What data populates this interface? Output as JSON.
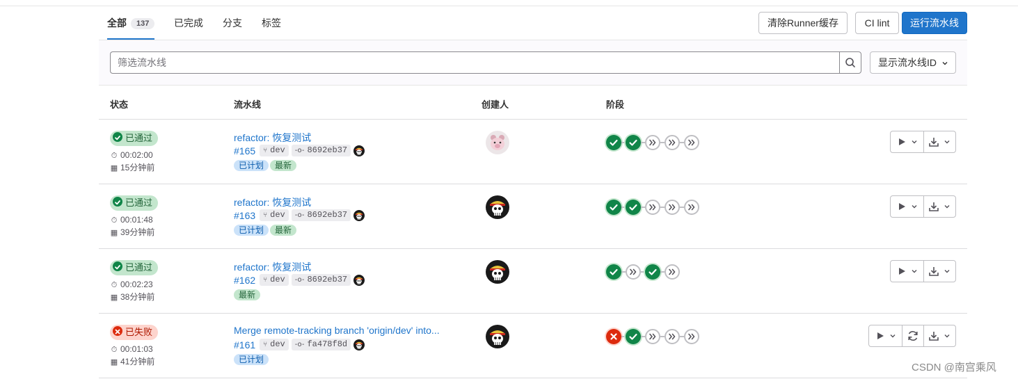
{
  "tabs": [
    {
      "label": "全部",
      "count": "137"
    },
    {
      "label": "已完成"
    },
    {
      "label": "分支"
    },
    {
      "label": "标签"
    }
  ],
  "actions": {
    "clear_cache": "清除Runner缓存",
    "ci_lint": "CI lint",
    "run_pipeline": "运行流水线"
  },
  "filter": {
    "placeholder": "筛选流水线",
    "id_select": "显示流水线ID"
  },
  "columns": {
    "status": "状态",
    "pipeline": "流水线",
    "creator": "创建人",
    "stages": "阶段"
  },
  "rows": [
    {
      "status": "已通过",
      "status_kind": "passed",
      "duration": "00:02:00",
      "finished": "15分钟前",
      "title": "refactor: 恢复测试",
      "id": "#165",
      "branch": "dev",
      "commit": "8692eb37",
      "badges": [
        {
          "label": "已计划",
          "kind": "blue"
        },
        {
          "label": "最新",
          "kind": "green"
        }
      ],
      "avatar": "pig",
      "stages": [
        "passed",
        "passed",
        "skipped",
        "skipped",
        "skipped"
      ],
      "has_retry": false
    },
    {
      "status": "已通过",
      "status_kind": "passed",
      "duration": "00:01:48",
      "finished": "39分钟前",
      "title": "refactor: 恢复测试",
      "id": "#163",
      "branch": "dev",
      "commit": "8692eb37",
      "badges": [
        {
          "label": "已计划",
          "kind": "blue"
        },
        {
          "label": "最新",
          "kind": "green"
        }
      ],
      "avatar": "skull",
      "stages": [
        "passed",
        "passed",
        "skipped",
        "skipped",
        "skipped"
      ],
      "has_retry": false
    },
    {
      "status": "已通过",
      "status_kind": "passed",
      "duration": "00:02:23",
      "finished": "38分钟前",
      "title": "refactor: 恢复测试",
      "id": "#162",
      "branch": "dev",
      "commit": "8692eb37",
      "badges": [
        {
          "label": "最新",
          "kind": "green"
        }
      ],
      "avatar": "skull",
      "stages": [
        "passed",
        "skipped",
        "passed",
        "skipped"
      ],
      "has_retry": false
    },
    {
      "status": "已失败",
      "status_kind": "failed",
      "duration": "00:01:03",
      "finished": "41分钟前",
      "title": "Merge remote-tracking branch 'origin/dev' into...",
      "id": "#161",
      "branch": "dev",
      "commit": "fa478f8d",
      "badges": [
        {
          "label": "已计划",
          "kind": "blue"
        }
      ],
      "avatar": "skull",
      "stages": [
        "failed",
        "passed",
        "skipped",
        "skipped",
        "skipped"
      ],
      "has_retry": true
    }
  ],
  "watermark": "CSDN @南宫乘风",
  "colors": {
    "accent": "#1f75cb",
    "success": "#108548",
    "danger": "#dd2b0e"
  }
}
